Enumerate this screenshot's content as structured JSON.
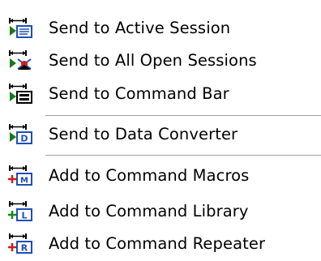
{
  "menu": {
    "items": [
      {
        "label": "Send to Active Session",
        "icon": "send-to-session-icon"
      },
      {
        "label": "Send to All Open Sessions",
        "icon": "send-to-all-sessions-icon"
      },
      {
        "label": "Send to Command Bar",
        "icon": "send-to-command-bar-icon"
      },
      {
        "label": "Send to Data Converter",
        "icon": "send-to-data-converter-icon"
      },
      {
        "label": "Add to Command Macros",
        "icon": "add-to-macros-icon"
      },
      {
        "label": "Add to Command Library",
        "icon": "add-to-library-icon"
      },
      {
        "label": "Add to Command Repeater",
        "icon": "add-to-repeater-icon"
      }
    ]
  },
  "colors": {
    "arrow": "#1a7a1a",
    "box_blue": "#1f4fb5",
    "plus_green": "#1a8a1a",
    "separator": "#a0a0a0"
  }
}
